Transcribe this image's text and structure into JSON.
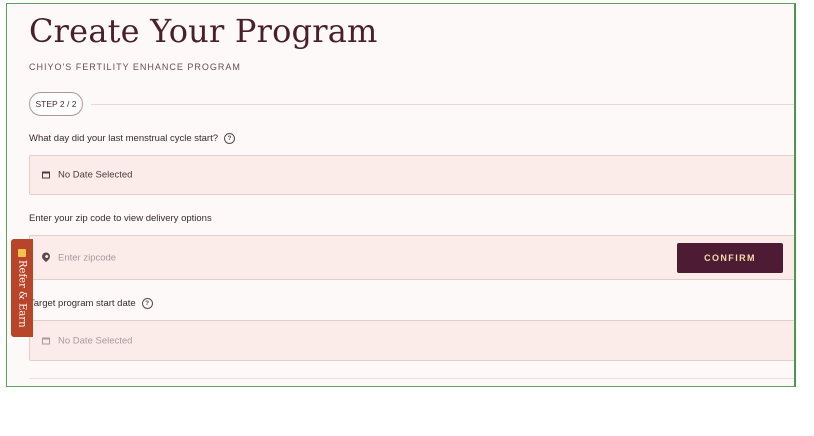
{
  "header": {
    "title": "Create Your Program",
    "subtitle": "CHIYO'S FERTILITY ENHANCE PROGRAM"
  },
  "step": {
    "label": "STEP 2 / 2"
  },
  "cycle": {
    "question": "What day did your last menstrual cycle start?",
    "value": "No Date Selected",
    "icon": "calendar-icon"
  },
  "zip": {
    "question": "Enter your zip code to view delivery options",
    "placeholder": "Enter zipcode",
    "icon": "location-pin-icon",
    "confirm_label": "CONFIRM"
  },
  "start_date": {
    "question": "Target program start date",
    "value": "No Date Selected",
    "icon": "calendar-icon"
  },
  "refer_tab": {
    "label": "Refer & Earn",
    "icon": "gift-icon"
  },
  "colors": {
    "brand": "#4d1b34",
    "accent": "#f3dca9",
    "refer_tab": "#b7452a",
    "field_bg": "#fbece9"
  }
}
